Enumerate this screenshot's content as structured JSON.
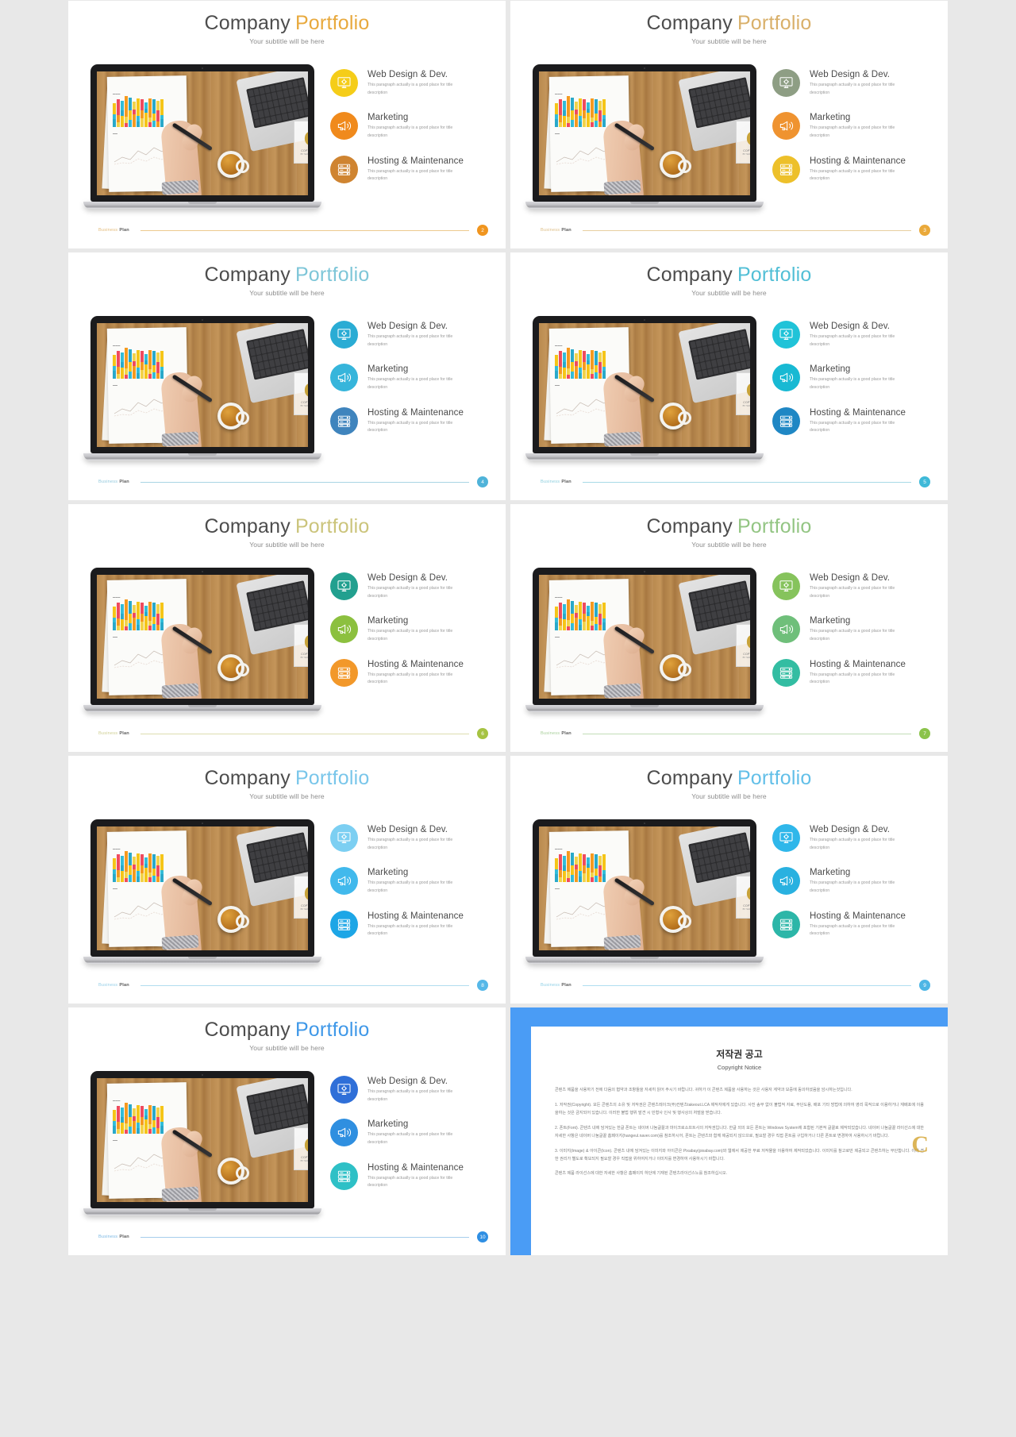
{
  "common": {
    "title_part1": "Company",
    "title_part2": "Portfolio",
    "subtitle": "Your subtitle will be here",
    "footer_label_1": "Business",
    "footer_label_2": "Plan",
    "feature_desc": "This paragraph  actually is a good place for title description",
    "watermark_letter": "C",
    "watermark_line1": "COPYRIGHTS",
    "watermark_line2": "BY SLIDEMEMBERS",
    "features": [
      {
        "title": "Web Design & Dev.",
        "icon": "monitor-gear-icon"
      },
      {
        "title": "Marketing",
        "icon": "megaphone-icon"
      },
      {
        "title": "Hosting & Maintenance",
        "icon": "server-rack-icon"
      }
    ]
  },
  "slides": [
    {
      "id": "slide-2",
      "page_number": "2",
      "accent": "#f2a92c",
      "title_color": "#e8a93d",
      "footer_text_color": "#e3bb7a",
      "footer_line_color": "#edc98e",
      "badge_color": "#f0951f",
      "icon_colors": [
        "#f5cd19",
        "#f08a1c",
        "#cf8431"
      ]
    },
    {
      "id": "slide-3",
      "page_number": "3",
      "accent": "#d6ab55",
      "title_color": "#d9b06a",
      "footer_text_color": "#ddbe86",
      "footer_line_color": "#e8cfa0",
      "badge_color": "#eaa93a",
      "icon_colors": [
        "#8e9e84",
        "#ef9330",
        "#edc02a"
      ]
    },
    {
      "id": "slide-4",
      "page_number": "4",
      "accent": "#5bb7d4",
      "title_color": "#7ec6d8",
      "footer_text_color": "#93c9dd",
      "footer_line_color": "#a9d4e4",
      "badge_color": "#4fb3d9",
      "icon_colors": [
        "#2aacd4",
        "#36b5db",
        "#3f84bd"
      ]
    },
    {
      "id": "slide-5",
      "page_number": "5",
      "accent": "#4fc0d8",
      "title_color": "#52bfd6",
      "footer_text_color": "#8dcede",
      "footer_line_color": "#a7dae7",
      "badge_color": "#3fb9d8",
      "icon_colors": [
        "#20c3d8",
        "#18b9d3",
        "#1f87c4"
      ]
    },
    {
      "id": "slide-6",
      "page_number": "6",
      "accent": "#c3c271",
      "title_color": "#cbc47b",
      "footer_text_color": "#cfcf93",
      "footer_line_color": "#ddddae",
      "badge_color": "#a6c342",
      "icon_colors": [
        "#22a08f",
        "#8cc03f",
        "#f2982a"
      ]
    },
    {
      "id": "slide-7",
      "page_number": "7",
      "accent": "#8cc07c",
      "title_color": "#93c583",
      "footer_text_color": "#a8cf9a",
      "footer_line_color": "#c2ddb7",
      "badge_color": "#8bc34a",
      "icon_colors": [
        "#86c35c",
        "#6fbf7a",
        "#33bda2"
      ]
    },
    {
      "id": "slide-8",
      "page_number": "8",
      "accent": "#6dc1e8",
      "title_color": "#79c6ea",
      "footer_text_color": "#95cfe8",
      "footer_line_color": "#b1dcef",
      "badge_color": "#56b8e8",
      "icon_colors": [
        "#7ccff2",
        "#41b9ec",
        "#1da6e6"
      ]
    },
    {
      "id": "slide-9",
      "page_number": "9",
      "accent": "#57b9e6",
      "title_color": "#62bfe8",
      "footer_text_color": "#8fd0e6",
      "footer_line_color": "#b0def0",
      "badge_color": "#4eb6e5",
      "icon_colors": [
        "#2fb7ea",
        "#29b1e0",
        "#2cb6a8"
      ]
    },
    {
      "id": "slide-10",
      "page_number": "10",
      "accent": "#3b95e6",
      "title_color": "#3f98e8",
      "footer_text_color": "#7bb8e4",
      "footer_line_color": "#a7cdec",
      "badge_color": "#2f8fe3",
      "icon_colors": [
        "#2f6fd8",
        "#2f8fe0",
        "#2ec0c6"
      ]
    }
  ],
  "copyright_slide": {
    "id": "copyright-notice-slide",
    "border_color": "#4a9cf5",
    "title_ko": "저작권 공고",
    "title_en": "Copyright Notice",
    "mark_letter": "C",
    "paragraphs": [
      "콘텐츠 제품을 사용하기 전에 다음의 협약과 조항들을 자세히 읽어 주시기 바랍니다. 귀하가 이 콘텐츠 제품을 사용하는 것은 사용자 계약과 보증에 동의하셨음을 암시하는것입니다.",
      "1. 저작권(Copyright). 모든 콘텐츠의 소유 및 저작권은 콘텐츠레이크(주)컨텐츠takeout.LCA 제작자에게 있습니다. 사진 송부 없이 불법적 자료, 무단도용, 배포 기타 방법에 의하여 영리 목적으로 이용하거나 재배포에 이용을하는 것은 금지되어 있습니다. 이러한 불법 행위 발견 시 민형사 인사 및 행사상의 처벌을 받습니다.",
      "2. 폰트(Font). 콘텐츠 내에 담겨있는 한글 폰트는 네이버 나눔글꼴과 마이크로소프트사의 저작권입니다. 한글 외의 모든 폰트는 Windows System에 포함된 기본적 글꼴로 제작되었습니다. 네이버 나눔글꼴 라이선스에 대한 자세한 사항은 네이버 나눔글꼴 홈페이지(hangeul.naver.com)를 참조하시어, 폰트는 콘텐츠와 함께 제공되지 않으므로, 필요할 경우 직접 폰트를 구입하거나 다른 폰트로 변경하여 사용하시기 바랍니다.",
      "3. 이미지(Image) & 아이콘(Icon). 콘텐츠 내에 담겨있는 이미지와 아이콘은 Pixabay(pixabay.com)와 웹에서 제공한 무료 저작물을 이용하여 제작되었습니다. 이미지를 참고로만 제공되고 콘텐츠하는 무단합니다. 이에 견한 권리가 별도로 확보되지 필요할 경우 직접을 위하여지거나 이미지를 변경하여 사용하시기 바랍니다.",
      "콘텐츠 제품 라이선스에 대한 자세한 사항은 홈페이지 하단에 기재된 콘텐츠라이선스노를 참조하십시오."
    ]
  }
}
